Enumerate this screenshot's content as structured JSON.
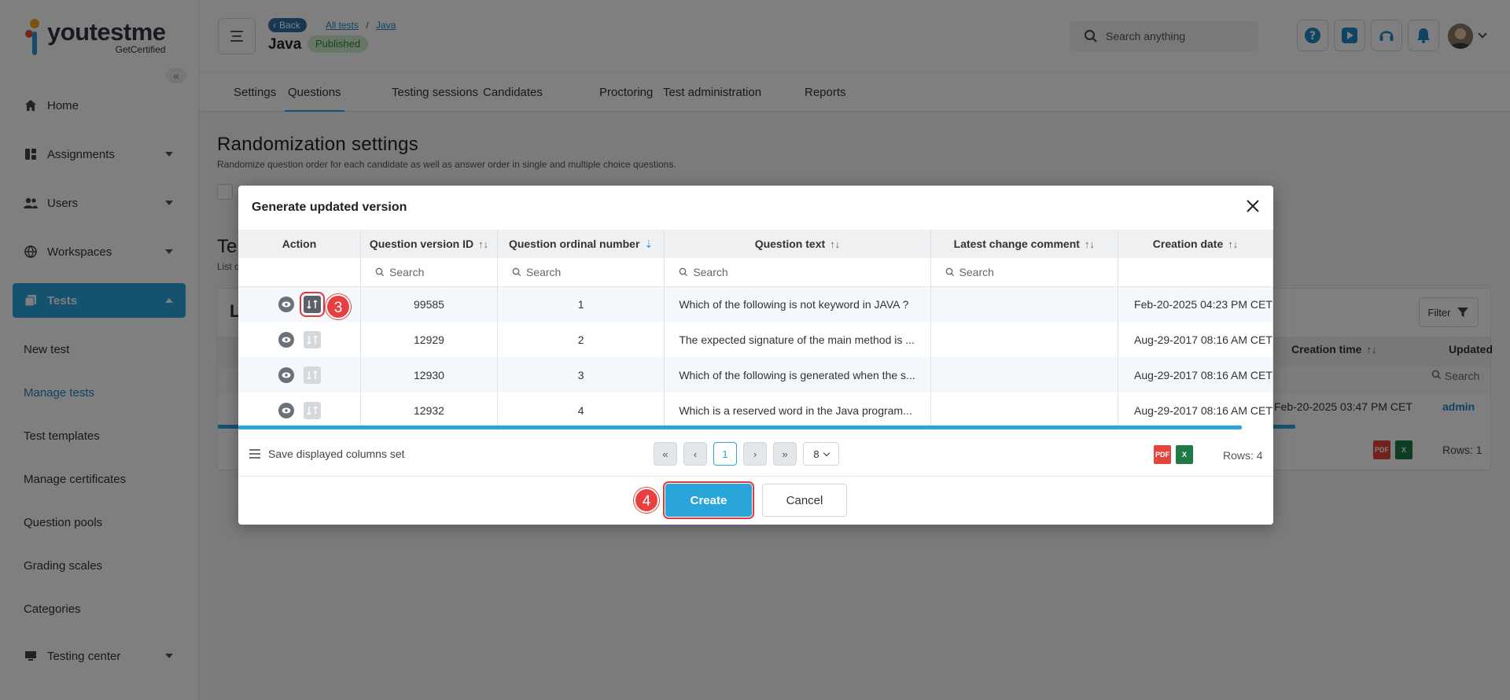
{
  "app": {
    "logo_title": "youtestme",
    "logo_subtitle": "GetCertified"
  },
  "sidebar": {
    "items": [
      {
        "label": "Home",
        "icon": "home-icon"
      },
      {
        "label": "Assignments",
        "icon": "assignments-icon"
      },
      {
        "label": "Users",
        "icon": "users-icon"
      },
      {
        "label": "Workspaces",
        "icon": "workspaces-icon"
      },
      {
        "label": "Tests",
        "icon": "tests-icon"
      }
    ],
    "sub_items": [
      "New test",
      "Manage tests",
      "Test templates",
      "Manage certificates",
      "Question pools",
      "Grading scales",
      "Categories"
    ],
    "current_sub": "Manage tests",
    "bottom_item": {
      "label": "Testing center",
      "icon": "testing-center-icon"
    }
  },
  "header": {
    "back_label": "Back",
    "breadcrumb": [
      "All tests",
      "Java"
    ],
    "page_name": "Java",
    "status_badge": "Published",
    "search_placeholder": "Search anything"
  },
  "tabs": [
    "Settings",
    "Questions",
    "Testing sessions",
    "Candidates",
    "Proctoring",
    "Test administration",
    "Reports"
  ],
  "active_tab": "Questions",
  "main": {
    "title": "Randomization settings",
    "subtitle": "Randomize question order for each candidate as well as answer order in single and multiple choice questions.",
    "section_title_partial": "Te",
    "section_sub_partial": "List c",
    "card_title_partial": "L",
    "filter_label": "Filter",
    "bg_columns": [
      "Creation time",
      "Updated"
    ],
    "bg_search": "Search",
    "bg_row": {
      "creation_time": "Feb-20-2025 03:47 PM CET",
      "updated": "admin"
    },
    "bg_rows": "Rows: 1"
  },
  "modal": {
    "title": "Generate updated version",
    "columns": [
      {
        "label": "Action",
        "sortable": false
      },
      {
        "label": "Question version ID",
        "sortable": true
      },
      {
        "label": "Question ordinal number",
        "sortable": true,
        "active": true
      },
      {
        "label": "Question text",
        "sortable": true
      },
      {
        "label": "Latest change comment",
        "sortable": true
      },
      {
        "label": "Creation date",
        "sortable": true
      }
    ],
    "search_placeholder": "Search",
    "rows": [
      {
        "version_id": "99585",
        "ordinal": "1",
        "text": "Which of the following is not keyword in JAVA ?",
        "comment": "",
        "created": "Feb-20-2025 04:23 PM CET",
        "action_enabled": true
      },
      {
        "version_id": "12929",
        "ordinal": "2",
        "text": "The expected signature of the main method is ...",
        "comment": "",
        "created": "Aug-29-2017 08:16 AM CET",
        "action_enabled": false
      },
      {
        "version_id": "12930",
        "ordinal": "3",
        "text": "Which of the following is generated when the s...",
        "comment": "",
        "created": "Aug-29-2017 08:16 AM CET",
        "action_enabled": false
      },
      {
        "version_id": "12932",
        "ordinal": "4",
        "text": "Which is a reserved word in the Java program...",
        "comment": "",
        "created": "Aug-29-2017 08:16 AM CET",
        "action_enabled": false
      }
    ],
    "save_columns_label": "Save displayed columns set",
    "current_page": "1",
    "page_size": "8",
    "rows_label": "Rows: 4",
    "create_label": "Create",
    "cancel_label": "Cancel",
    "step_badges": [
      "3",
      "4"
    ]
  }
}
